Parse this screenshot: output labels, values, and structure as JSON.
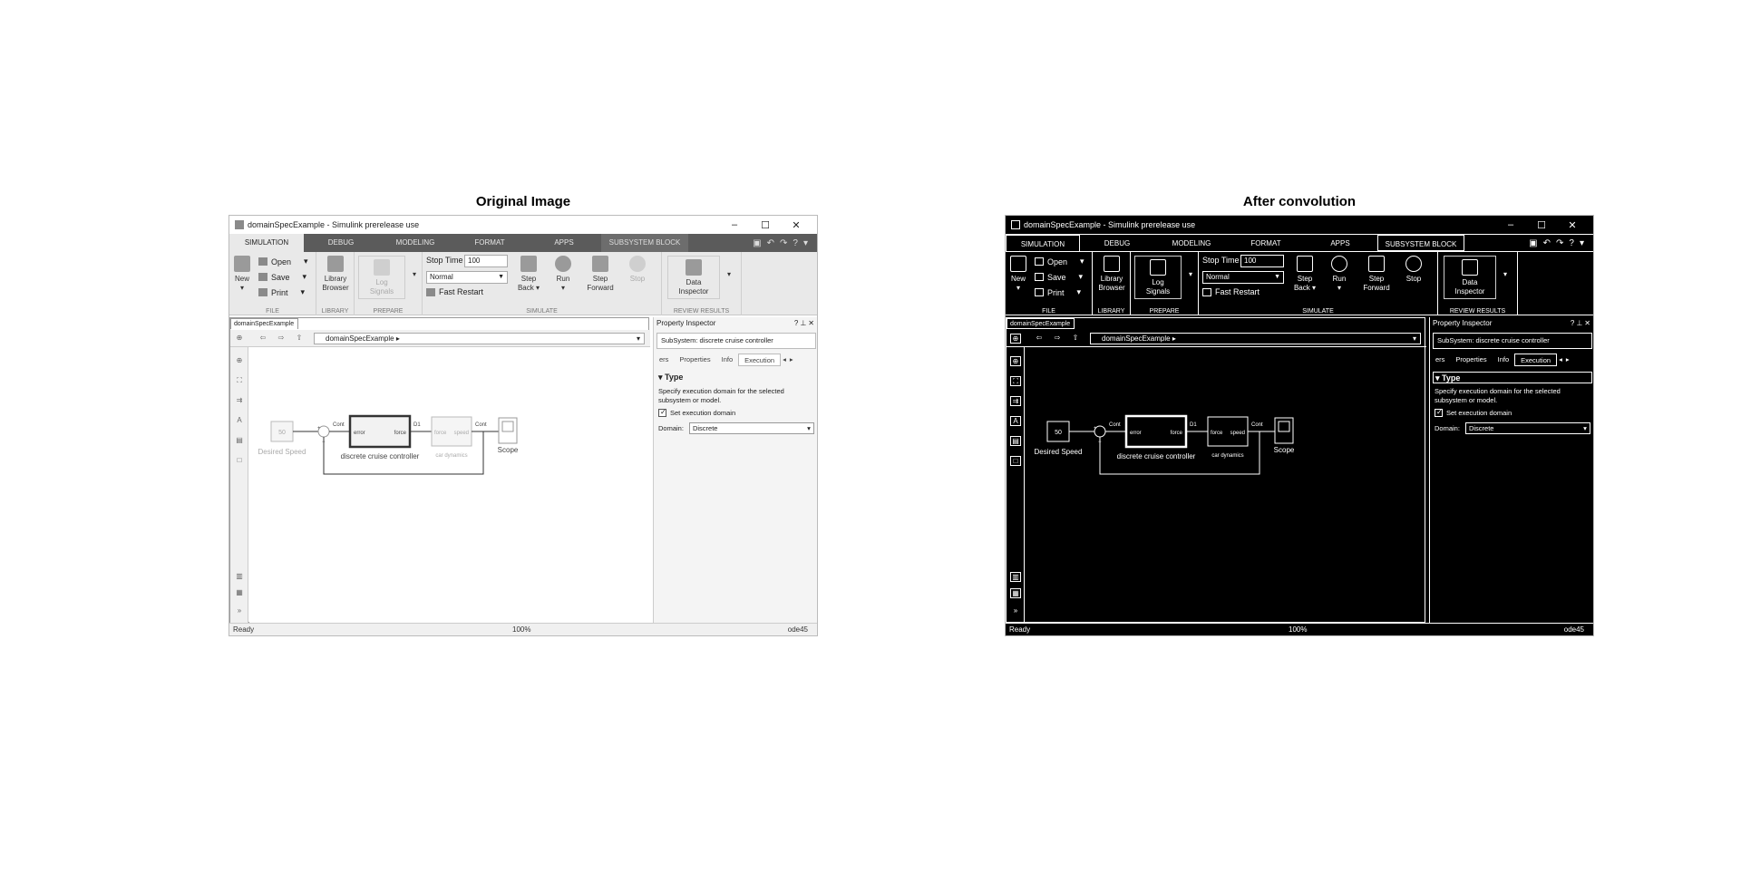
{
  "figure": {
    "left_title": "Original Image",
    "right_title": "After convolution"
  },
  "window": {
    "title": "domainSpecExample - Simulink prerelease use",
    "minimize": "–",
    "maximize": "☐",
    "close": "✕"
  },
  "tabs": [
    {
      "label": "SIMULATION"
    },
    {
      "label": "DEBUG"
    },
    {
      "label": "MODELING"
    },
    {
      "label": "FORMAT"
    },
    {
      "label": "APPS"
    },
    {
      "label": "SUBSYSTEM BLOCK"
    }
  ],
  "ribbon": {
    "file": {
      "label": "FILE",
      "new": "New",
      "open": "Open",
      "save": "Save",
      "print": "Print"
    },
    "library": {
      "label": "LIBRARY",
      "browser_line1": "Library",
      "browser_line2": "Browser"
    },
    "prepare": {
      "label": "PREPARE",
      "log_line1": "Log",
      "log_line2": "Signals"
    },
    "simulate": {
      "label": "SIMULATE",
      "stop_time_label": "Stop Time",
      "stop_time_value": "100",
      "mode": "Normal",
      "fast_restart": "Fast Restart",
      "step_back_line1": "Step",
      "step_back_line2": "Back",
      "run": "Run",
      "step_forward_line1": "Step",
      "step_forward_line2": "Forward",
      "stop": "Stop"
    },
    "review": {
      "label": "REVIEW RESULTS",
      "data_line1": "Data",
      "data_line2": "Inspector"
    }
  },
  "editor": {
    "model_tab": "domainSpecExample",
    "breadcrumb": "domainSpecExample"
  },
  "diagram": {
    "desired_speed_value": "50",
    "desired_speed": "Desired Speed",
    "cont_label": "Cont",
    "d1_label": "D1",
    "controller_in": "error",
    "controller_out": "force",
    "controller_name": "discrete cruise controller",
    "dynamics_in": "force",
    "dynamics_out": "speed",
    "dynamics_name": "car dynamics",
    "cont2_label": "Cont",
    "scope": "Scope",
    "sum_plus": "+",
    "sum_minus": "−"
  },
  "inspector": {
    "title": "Property Inspector",
    "selection": "SubSystem: discrete cruise controller",
    "tabs": [
      "ers",
      "Properties",
      "Info",
      "Execution"
    ],
    "section": "Type",
    "description": "Specify execution domain for the selected subsystem or model.",
    "checkbox_label": "Set execution domain",
    "domain_label": "Domain:",
    "domain_value": "Discrete"
  },
  "status": {
    "left": "Ready",
    "zoom": "100%",
    "solver": "ode45"
  }
}
